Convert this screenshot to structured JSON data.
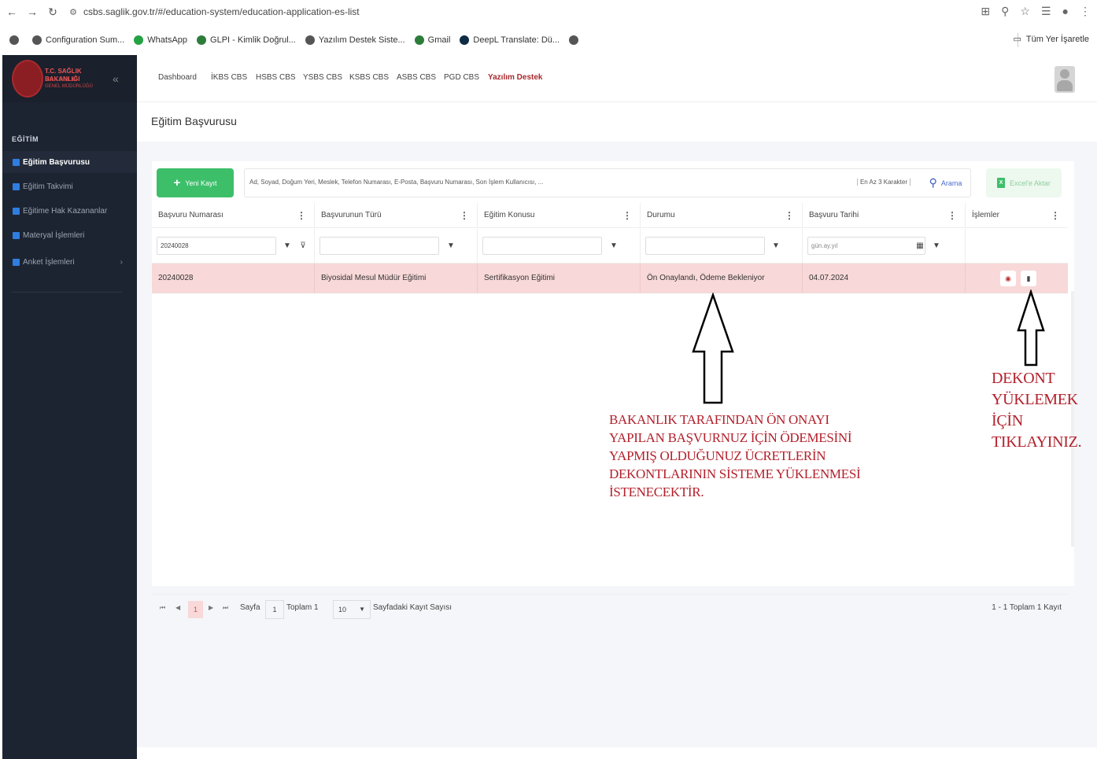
{
  "browser": {
    "url": "csbs.saglik.gov.tr/#/education-system/education-application-es-list",
    "bookmarks": [
      "Configuration Sum...",
      "WhatsApp",
      "GLPI - Kimlik Doğrul...",
      "Yazılım Destek Siste...",
      "Gmail",
      "DeepL Translate: Dü..."
    ],
    "bookmarks_right": "Tüm Yer İşaretle"
  },
  "logo": {
    "title": "T.C. SAĞLIK BAKANLIĞI",
    "sub1": "HALK SAĞLIĞI",
    "sub2": "GENEL MÜDÜRLÜĞÜ"
  },
  "sidebar": {
    "section": "EĞİTİM",
    "items": [
      {
        "label": "Eğitim Başvurusu",
        "active": true
      },
      {
        "label": "Eğitim Takvimi"
      },
      {
        "label": "Eğitime Hak Kazananlar"
      },
      {
        "label": "Materyal İşlemleri"
      },
      {
        "label": "Anket İşlemleri"
      }
    ]
  },
  "topnav": [
    "Dashboard",
    "İKBS CBS",
    "HSBS CBS",
    "YSBS CBS",
    "KSBS CBS",
    "ASBS CBS",
    "PGD CBS",
    "Yazılım Destek"
  ],
  "page_title": "Eğitim Başvurusu",
  "toolbar": {
    "new_label": "Yeni Kayıt",
    "search_placeholder": "Ad, Soyad, Doğum Yeri, Meslek, Telefon Numarası, E-Posta, Başvuru Numarası, Son İşlem Kullanıcısı, ...",
    "search_hint": "En Az 3 Karakter",
    "search_label": "Arama",
    "excel_label": "Excel'e Aktar"
  },
  "grid": {
    "columns": [
      "Başvuru Numarası",
      "Başvurunun Türü",
      "Eğitim Konusu",
      "Durumu",
      "Başvuru Tarihi",
      "İşlemler"
    ],
    "filters": {
      "number": "20240028",
      "date_placeholder": "gün.ay.yıl"
    },
    "rows": [
      {
        "number": "20240028",
        "type": "Biyosidal Mesul Müdür Eğitimi",
        "topic": "Sertifikasyon Eğitimi",
        "status": "Ön Onaylandı, Ödeme Bekleniyor",
        "date": "04.07.2024"
      }
    ]
  },
  "pager": {
    "current": "1",
    "page_label": "Sayfa",
    "page_value": "1",
    "total_label": "Toplam 1",
    "page_size": "10",
    "page_size_label": "Sayfadaki Kayıt Sayısı",
    "summary": "1 - 1 Toplam 1 Kayıt"
  },
  "annotations": {
    "center": "BAKANLIK TARAFINDAN ÖN ONAYI\nYAPILAN BAŞVURNUZ İÇİN ÖDEMESİNİ\nYAPMIŞ OLDUĞUNUZ ÜCRETLERİN\nDEKONTLARININ SİSTEME YÜKLENMESİ\nİSTENECEKTİR.",
    "right": "DEKONT\nYÜKLEMEK\nİÇİN\nTIKLAYINIZ."
  },
  "colors": {
    "accent": "#a82a2e",
    "success": "#3dbf6a",
    "row_highlight": "#f8d8d8",
    "sidebar": "#1d2431",
    "annotation": "#b2202b"
  }
}
